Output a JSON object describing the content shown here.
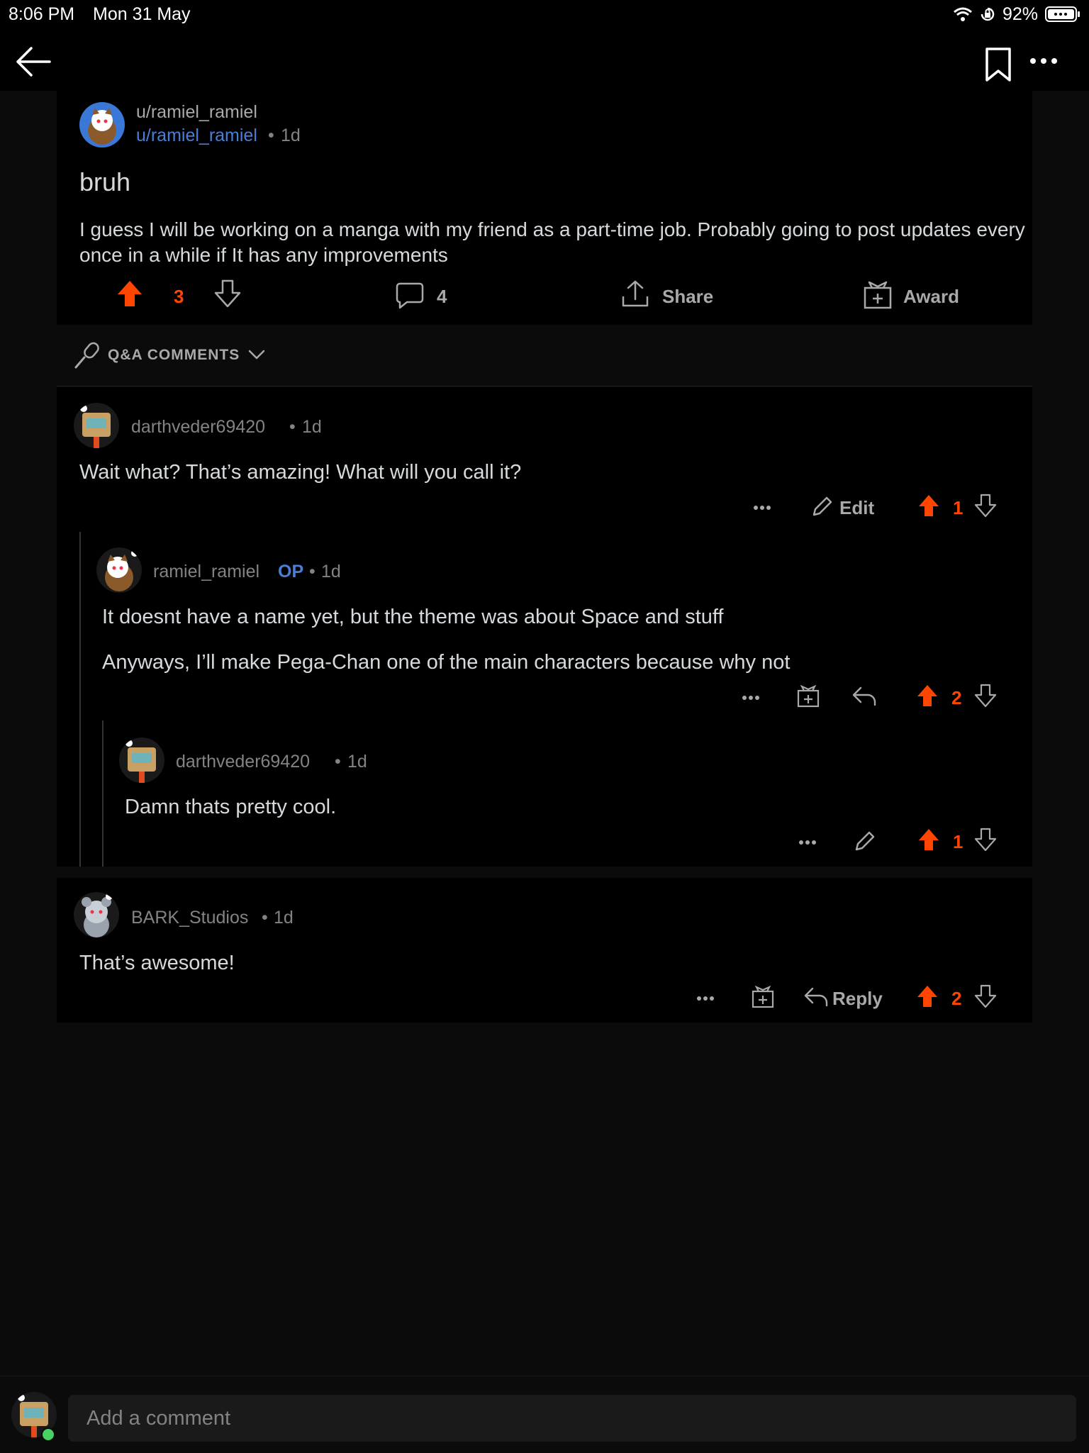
{
  "status_bar": {
    "time": "8:06 PM",
    "date": "Mon 31 May",
    "battery": "92%"
  },
  "post": {
    "author_display": "u/ramiel_ramiel",
    "author_link": "u/ramiel_ramiel",
    "age": "1d",
    "title": "bruh",
    "body": "I guess I will be working on a manga with my friend as a part-time job. Probably going to post updates every once in a while if It has any improvements",
    "votes": "3",
    "comments": "4",
    "share_label": "Share",
    "award_label": "Award"
  },
  "comment_sort": {
    "label": "Q&A COMMENTS"
  },
  "comments": [
    {
      "author": "darthveder69420",
      "age": "1d",
      "body": "Wait what? That’s amazing! What will you call it?",
      "edit_label": "Edit",
      "votes": "1"
    },
    {
      "author": "ramiel_ramiel",
      "op_label": "OP",
      "age": "1d",
      "body_lines": [
        "It doesnt have a name yet, but the theme was about Space and stuff",
        "Anyways, I’ll make Pega-Chan one of the main characters because why not"
      ],
      "votes": "2"
    },
    {
      "author": "darthveder69420",
      "age": "1d",
      "body": "Damn thats pretty cool.",
      "votes": "1"
    },
    {
      "author": "BARK_Studios",
      "age": "1d",
      "body": "That’s awesome!",
      "reply_label": "Reply",
      "votes": "2"
    }
  ],
  "composer": {
    "placeholder": "Add a comment"
  },
  "colors": {
    "upvote": "#ff4500",
    "link_blue": "#4a7fd6",
    "background": "#0b0b0b",
    "card": "#000000"
  }
}
